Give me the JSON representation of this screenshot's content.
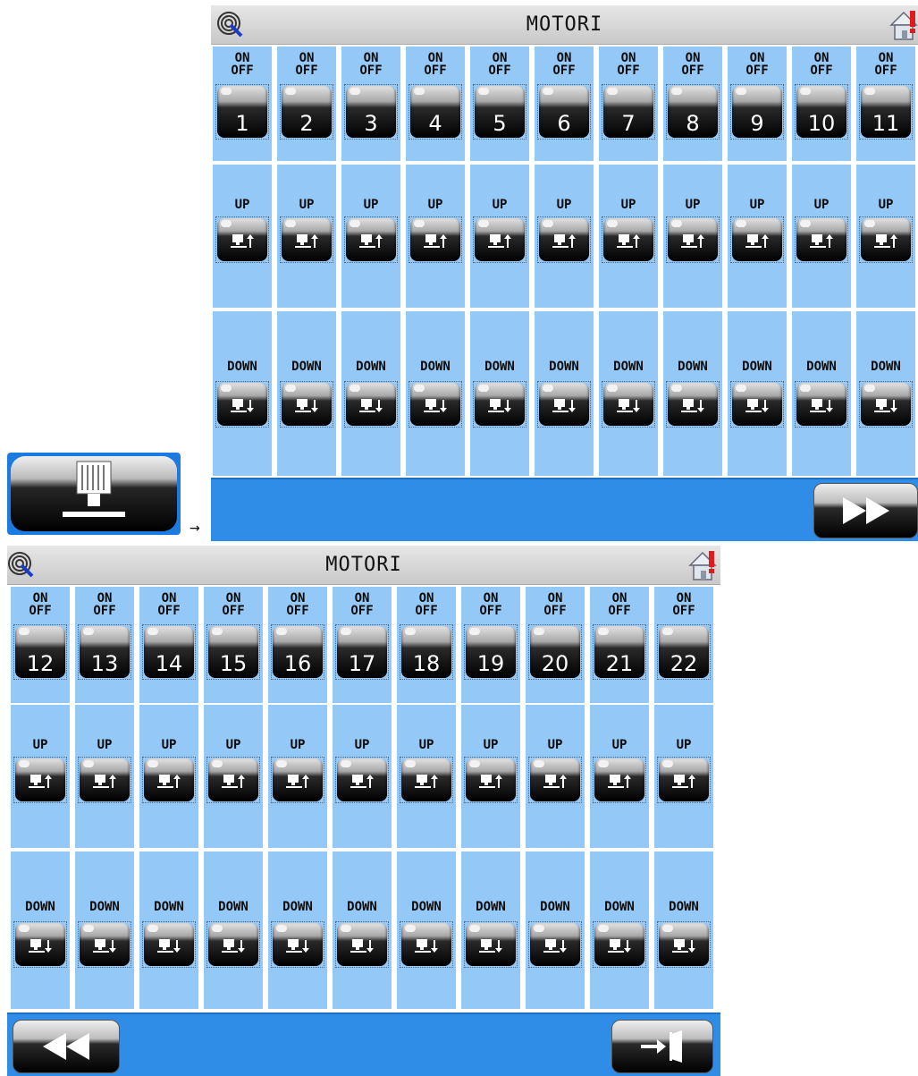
{
  "arrow": "→",
  "screen1": {
    "title": "MOTORI",
    "motors": [
      "1",
      "2",
      "3",
      "4",
      "5",
      "6",
      "7",
      "8",
      "9",
      "10",
      "11"
    ]
  },
  "screen2": {
    "title": "MOTORI",
    "motors": [
      "12",
      "13",
      "14",
      "15",
      "16",
      "17",
      "18",
      "19",
      "20",
      "21",
      "22"
    ]
  },
  "labels": {
    "on": "ON",
    "off": "OFF",
    "up": "UP",
    "down": "DOWN"
  },
  "icons": {
    "status": "radio-signal-icon",
    "home": "home-alert-icon",
    "forward": "fast-forward-icon",
    "back": "rewind-icon",
    "exit": "exit-door-icon",
    "motor": "motor-icon",
    "up": "motor-up-icon",
    "down": "motor-down-icon"
  },
  "colors": {
    "cell": "#93c8f7",
    "footer": "#2f8de8",
    "titlebar": "#d6d6d6"
  }
}
